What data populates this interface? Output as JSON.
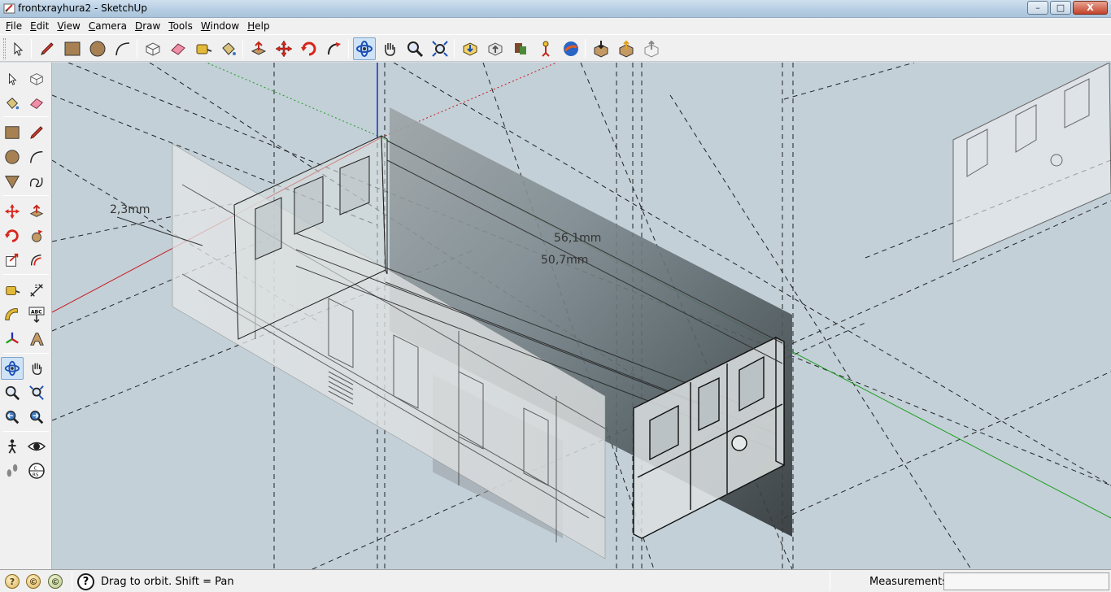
{
  "window": {
    "title": "frontxrayhura2 - SketchUp",
    "minimize": "–",
    "maximize": "□",
    "close": "X"
  },
  "menu": [
    {
      "label": "File",
      "underline": "F",
      "rest": "ile"
    },
    {
      "label": "Edit",
      "underline": "E",
      "rest": "dit"
    },
    {
      "label": "View",
      "underline": "V",
      "rest": "iew"
    },
    {
      "label": "Camera",
      "underline": "C",
      "rest": "amera"
    },
    {
      "label": "Draw",
      "underline": "D",
      "rest": "raw"
    },
    {
      "label": "Tools",
      "underline": "T",
      "rest": "ools"
    },
    {
      "label": "Window",
      "underline": "W",
      "rest": "indow"
    },
    {
      "label": "Help",
      "underline": "H",
      "rest": "elp"
    }
  ],
  "toolbar": {
    "tools": [
      "select-icon",
      "pencil-icon",
      "rectangle-icon",
      "circle-icon",
      "arc-icon",
      "make-component-icon",
      "eraser-icon",
      "tape-measure-icon",
      "paint-bucket-icon",
      "push-pull-icon",
      "move-icon",
      "rotate-icon",
      "follow-me-icon",
      "orbit-icon",
      "pan-icon",
      "zoom-icon",
      "zoom-extents-icon",
      "get-models-icon",
      "share-model-icon",
      "component-icon",
      "position-camera-icon",
      "google-earth-icon",
      "import-icon",
      "export-icon",
      "preview-icon"
    ],
    "active": "orbit-icon"
  },
  "palette": {
    "tools": [
      "select-icon",
      "make-component-icon",
      "paint-bucket-icon",
      "eraser-icon",
      "rectangle-icon",
      "line-icon",
      "circle-icon",
      "arc-icon",
      "polygon-icon",
      "freehand-icon",
      "move-icon",
      "push-pull-icon",
      "rotate-icon",
      "follow-me-icon",
      "scale-icon",
      "offset-icon",
      "tape-measure-icon",
      "dimension-icon",
      "protractor-icon",
      "text-icon",
      "axes-icon",
      "3d-text-icon",
      "orbit-icon",
      "pan-icon",
      "zoom-icon",
      "zoom-window-icon",
      "previous-view-icon",
      "next-view-icon",
      "walk-icon",
      "look-around-icon",
      "footprints-icon",
      "section-plane-icon"
    ],
    "active": "orbit-icon"
  },
  "viewport": {
    "dimensions": [
      "2,3mm",
      "56,1mm",
      "50,7mm"
    ],
    "background": "#c3d0d8",
    "axis_colors": {
      "red": "#c8191e",
      "green": "#1e9e1e",
      "blue": "#1f2fbf"
    }
  },
  "status": {
    "hint": "Drag to orbit.  Shift = Pan",
    "help": "?",
    "measurements_label": "Measurements",
    "measurements_value": "",
    "icons": [
      "geo-location-icon",
      "credits-icon",
      "user-icon"
    ]
  }
}
